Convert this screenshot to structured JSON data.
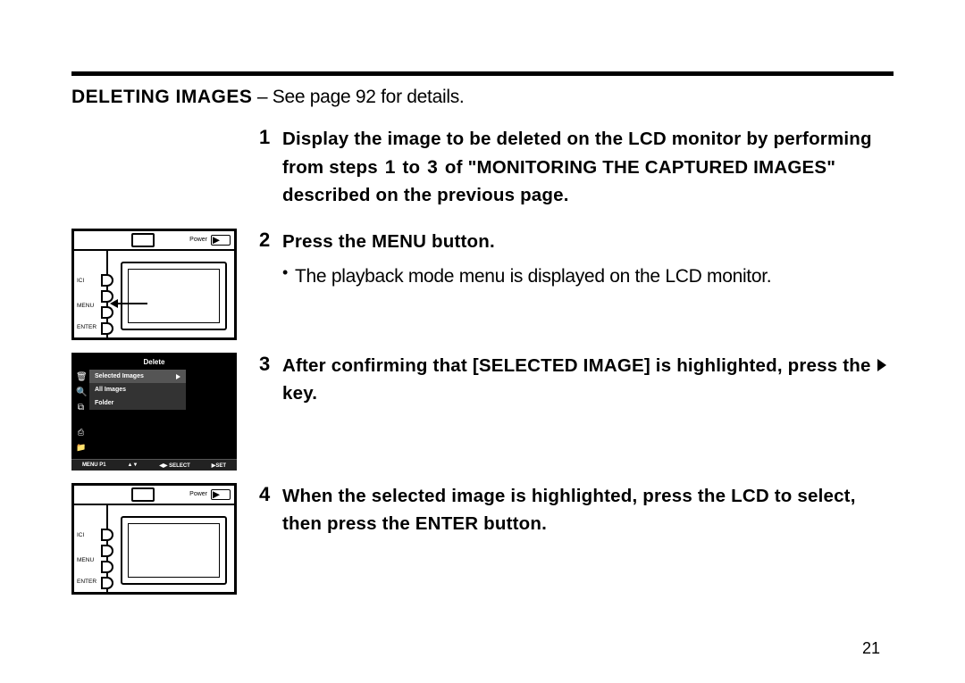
{
  "section": {
    "title_bold": "DELETING IMAGES",
    "title_rest": " – See page 92 for details."
  },
  "steps": {
    "s1": {
      "num": "1",
      "text_prefix": "Display the image to be deleted on the LCD monitor by performing from steps ",
      "one": "1",
      "mid1": " to ",
      "three": "3",
      "text_suffix": " of \"MONITORING THE CAPTURED IMAGES\" described on the previous page."
    },
    "s2": {
      "num": "2",
      "text": "Press the MENU button.",
      "sub": "The playback mode menu is displayed on the LCD monitor."
    },
    "s3": {
      "num": "3",
      "text_prefix": "After confirming that [SELECTED IMAGE] is highlighted, press the ",
      "text_suffix": " key."
    },
    "s4": {
      "num": "4",
      "text": "When the selected image is highlighted, press the LCD to select, then press the ENTER button."
    }
  },
  "camera_labels": {
    "power": "Power",
    "ici": "ICI",
    "menu": "MENU",
    "enter": "ENTER"
  },
  "menu_illu": {
    "title": "Delete",
    "item1": "Selected Images",
    "item2": "All Images",
    "item3": "Folder",
    "bottom": {
      "a": "MENU P1",
      "b": "▲▼",
      "c": "◀▶ SELECT",
      "d": "▶SET"
    }
  },
  "page_number": "21"
}
